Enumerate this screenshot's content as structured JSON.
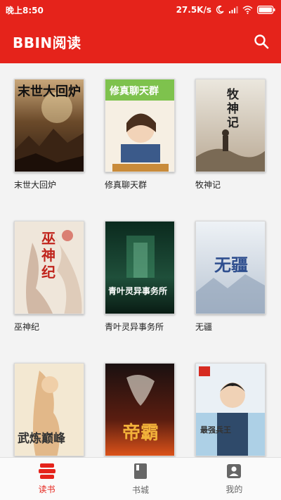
{
  "status_bar": {
    "time": "晚上8:50",
    "network_speed": "27.5K/s"
  },
  "app_bar": {
    "title": "BBIN阅读",
    "search_icon": "search-icon"
  },
  "books": [
    {
      "title": "末世大回炉",
      "cover_text": "末世大回炉"
    },
    {
      "title": "修真聊天群",
      "cover_text": "修真聊天群"
    },
    {
      "title": "牧神记",
      "cover_text": "牧神记"
    },
    {
      "title": "巫神纪",
      "cover_text": "巫神纪"
    },
    {
      "title": "青叶灵异事务所",
      "cover_text": "青叶灵异事务所"
    },
    {
      "title": "无疆",
      "cover_text": "无疆"
    },
    {
      "title": "",
      "cover_text": "武炼巅峰"
    },
    {
      "title": "",
      "cover_text": "帝霸"
    },
    {
      "title": "",
      "cover_text": "最强兵王"
    }
  ],
  "bottom_nav": {
    "items": [
      {
        "label": "读书",
        "icon": "bookshelf-icon",
        "active": true
      },
      {
        "label": "书城",
        "icon": "book-store-icon",
        "active": false
      },
      {
        "label": "我的",
        "icon": "profile-icon",
        "active": false
      }
    ]
  },
  "colors": {
    "accent": "#e5231b",
    "shelf_bg": "#f3f3f3"
  }
}
